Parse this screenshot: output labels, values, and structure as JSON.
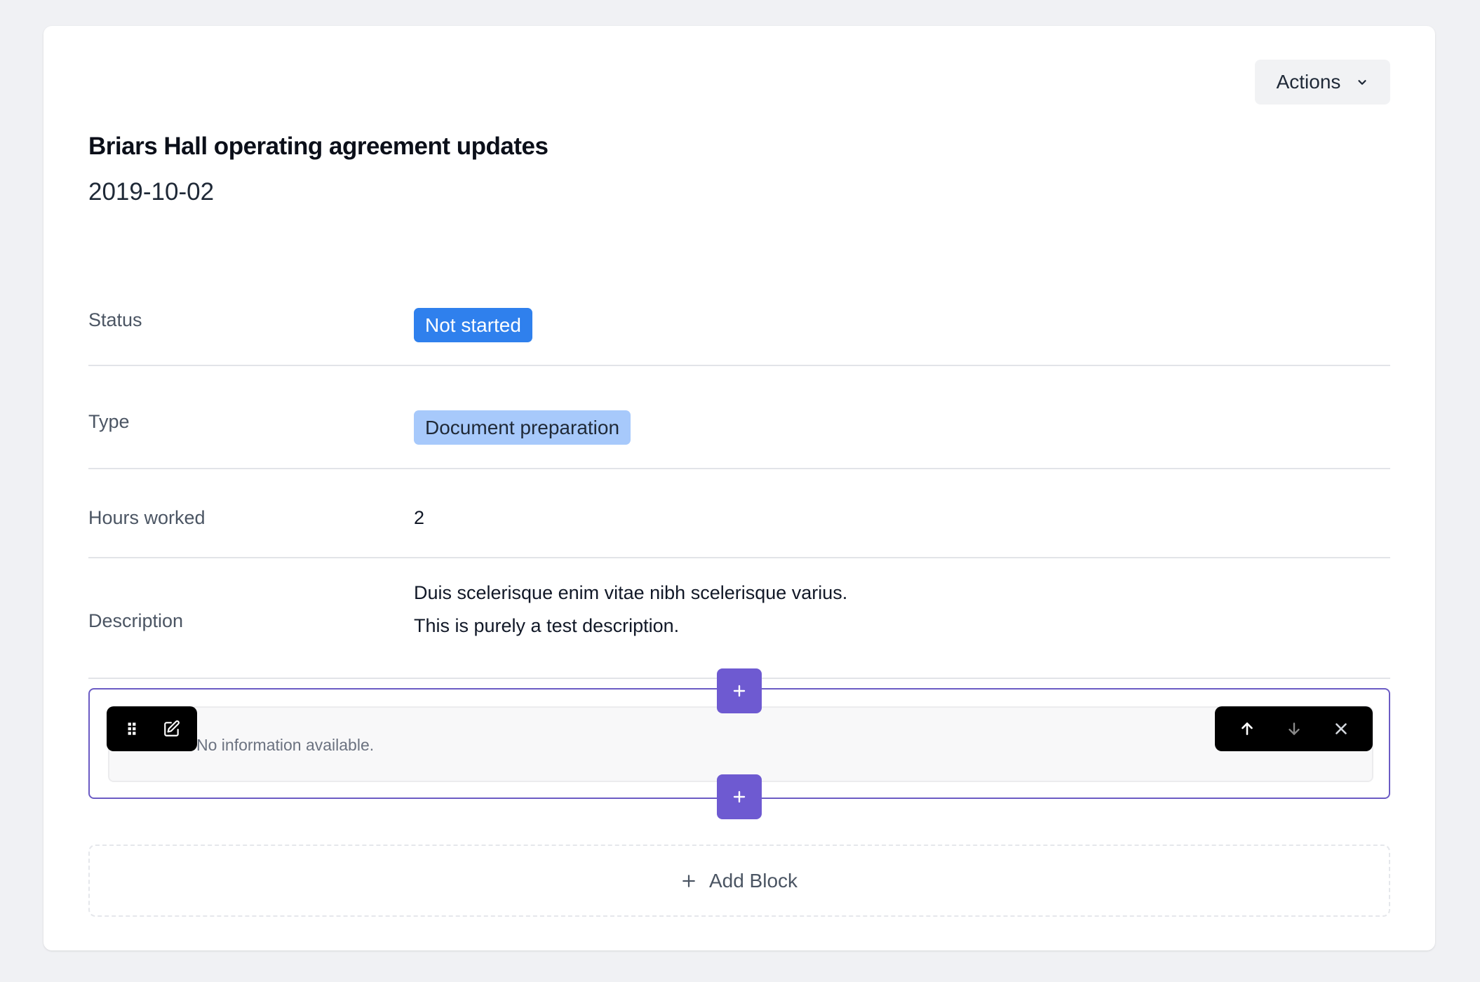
{
  "header": {
    "actions_label": "Actions",
    "title": "Briars Hall operating agreement updates",
    "date": "2019-10-02"
  },
  "fields": {
    "status": {
      "label": "Status",
      "value": "Not started"
    },
    "type": {
      "label": "Type",
      "value": "Document preparation"
    },
    "hours": {
      "label": "Hours worked",
      "value": "2"
    },
    "description": {
      "label": "Description",
      "line1": "Duis scelerisque enim vitae nibh scelerisque varius.",
      "line2": "This is purely a test description."
    }
  },
  "block": {
    "text": "No information available."
  },
  "add_block_label": "Add Block",
  "colors": {
    "status_badge": "#2f80ed",
    "type_badge": "#a7c9fb",
    "accent": "#6e5ad1",
    "block_border": "#6b5bc4"
  },
  "icons": {
    "actions": "chevron-down-icon",
    "drag": "drag-handle-icon",
    "edit": "edit-icon",
    "move_up": "arrow-up-icon",
    "move_down": "arrow-down-icon",
    "remove": "close-icon",
    "insert": "plus-icon"
  }
}
